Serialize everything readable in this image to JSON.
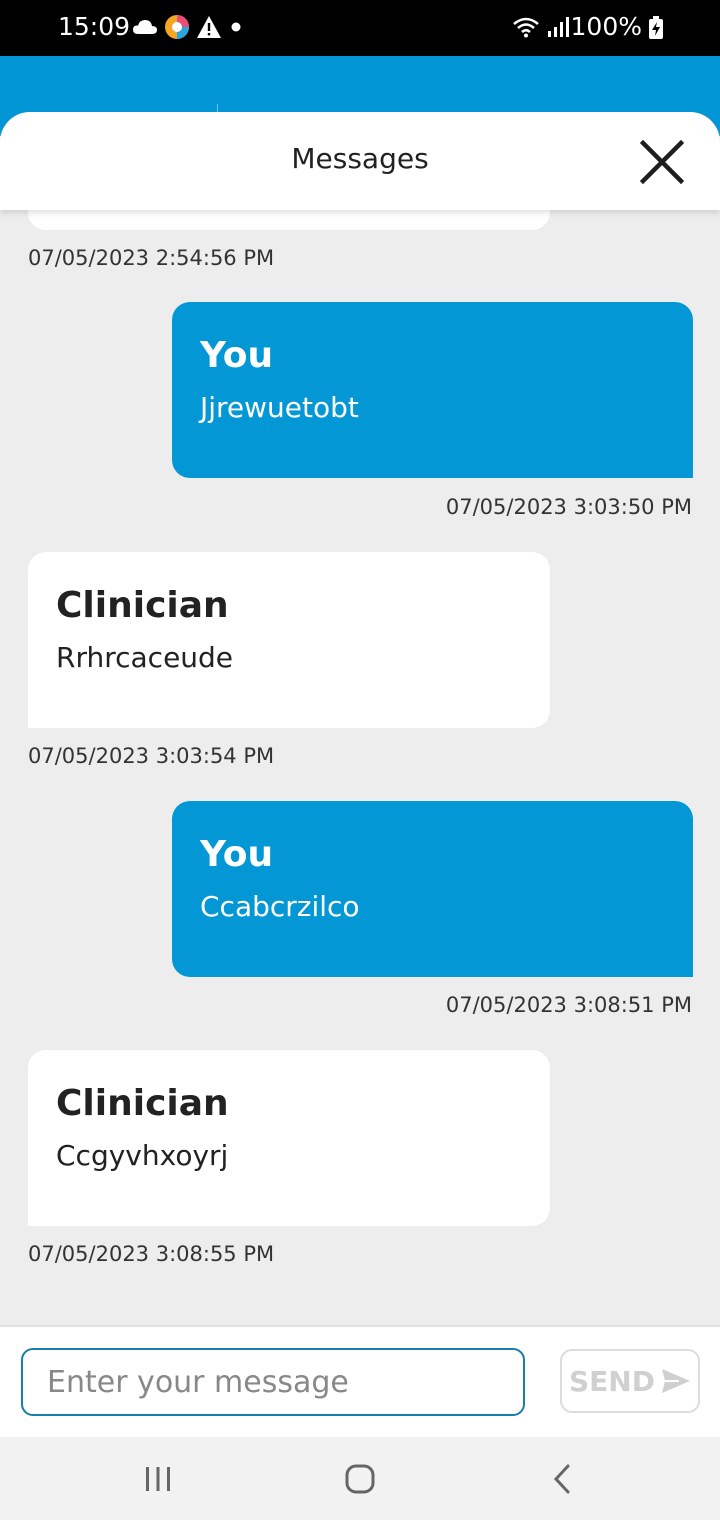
{
  "status_bar": {
    "time": "15:09",
    "battery": "100%"
  },
  "sheet": {
    "title": "Messages"
  },
  "messages": [
    {
      "role": "timestamp-only",
      "timestamp": "07/05/2023 2:54:56 PM"
    },
    {
      "role": "you",
      "sender": "You",
      "text": "Jjrewuetobt",
      "timestamp": "07/05/2023 3:03:50 PM"
    },
    {
      "role": "clinician",
      "sender": "Clinician",
      "text": "Rrhrcaceude",
      "timestamp": "07/05/2023 3:03:54 PM"
    },
    {
      "role": "you",
      "sender": "You",
      "text": "Ccabcrzilco",
      "timestamp": "07/05/2023 3:08:51 PM"
    },
    {
      "role": "clinician",
      "sender": "Clinician",
      "text": "Ccgyvhxoyrj",
      "timestamp": "07/05/2023 3:08:55 PM"
    }
  ],
  "composer": {
    "placeholder": "Enter your message",
    "value": "",
    "send_label": "SEND"
  },
  "icons": {
    "close": "close-icon",
    "send": "send-arrow-icon",
    "nav_recents": "recents-icon",
    "nav_home": "home-icon",
    "nav_back": "back-icon"
  },
  "colors": {
    "brand_blue": "#0397d6",
    "background": "#ededed",
    "bubble_other": "#ffffff"
  }
}
